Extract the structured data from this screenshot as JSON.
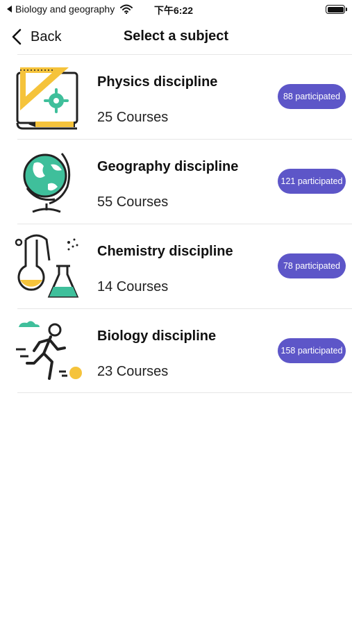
{
  "status_bar": {
    "back_app": "Biology and geography",
    "time": "下午6:22"
  },
  "nav": {
    "back_label": "Back",
    "title": "Select a subject"
  },
  "subjects": [
    {
      "title": "Physics discipline",
      "courses": "25 Courses",
      "participated": "88 participated",
      "icon": "physics-drafting-icon"
    },
    {
      "title": "Geography discipline",
      "courses": "55 Courses",
      "participated": "121 participated",
      "icon": "globe-icon"
    },
    {
      "title": "Chemistry discipline",
      "courses": "14 Courses",
      "participated": "78 participated",
      "icon": "flask-icon"
    },
    {
      "title": "Biology discipline",
      "courses": "23 Courses",
      "participated": "158 participated",
      "icon": "running-person-icon"
    }
  ],
  "colors": {
    "badge": "#5d56c8",
    "icon_yellow": "#f5c33b",
    "icon_green": "#3fbf9b",
    "icon_stroke": "#222222"
  }
}
